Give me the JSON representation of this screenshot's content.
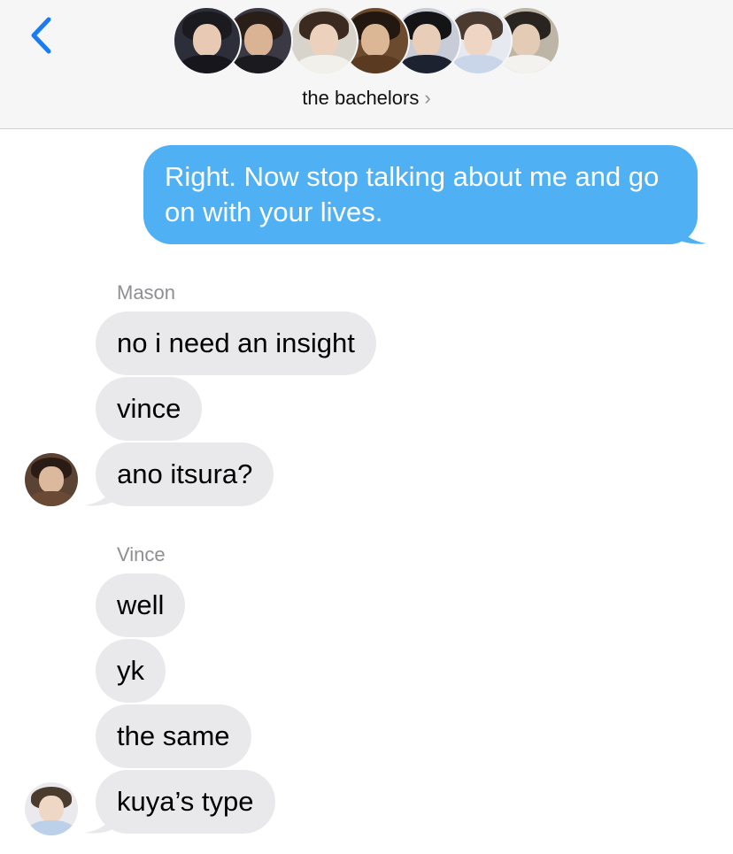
{
  "header": {
    "group_name": "the bachelors",
    "chevron": "›",
    "back_icon": "chevron-left-icon",
    "accent": "#1a7cf5",
    "member_avatars": [
      {
        "name": "member-1",
        "bg": "#2c2f3a",
        "hair": "#1a1a1f",
        "skin": "#e8c9b4",
        "body": "#16161c"
      },
      {
        "name": "member-2",
        "bg": "#3b3a44",
        "hair": "#2a1e18",
        "skin": "#d9b393",
        "body": "#1b1b1f"
      },
      {
        "name": "member-3",
        "bg": "#d8d4cc",
        "hair": "#3a2a20",
        "skin": "#ecd2bd",
        "body": "#f2f0ea"
      },
      {
        "name": "member-4",
        "bg": "#6b4a2e",
        "hair": "#22180f",
        "skin": "#dcb796",
        "body": "#5a3b22"
      },
      {
        "name": "member-5",
        "bg": "#c7ccd6",
        "hair": "#141416",
        "skin": "#e8cdb8",
        "body": "#1d2230"
      },
      {
        "name": "member-6",
        "bg": "#e6e9ef",
        "hair": "#4a3a30",
        "skin": "#efd6c4",
        "body": "#c9d6ea"
      },
      {
        "name": "member-7",
        "bg": "#bdb6a7",
        "hair": "#2a2420",
        "skin": "#e4cbb6",
        "body": "#f4f2ee"
      }
    ]
  },
  "thread": {
    "sent_message": "Right. Now stop talking about me and go on with your lives.",
    "sent_color": "#4fb0f3",
    "received_color": "#e9e9eb",
    "groups": [
      {
        "sender": "Mason",
        "avatar": {
          "bg": "#5b4334",
          "hair": "#2a1c14",
          "skin": "#dcb99c",
          "body": "#6a4a34"
        },
        "messages": [
          "no i need an insight",
          "vince",
          "ano itsura?"
        ]
      },
      {
        "sender": "Vince",
        "avatar": {
          "bg": "#eaeaee",
          "hair": "#4b3a2e",
          "skin": "#efd7c6",
          "body": "#bcd0ea"
        },
        "messages": [
          "well",
          "yk",
          "the same",
          "kuya’s type"
        ]
      }
    ]
  }
}
